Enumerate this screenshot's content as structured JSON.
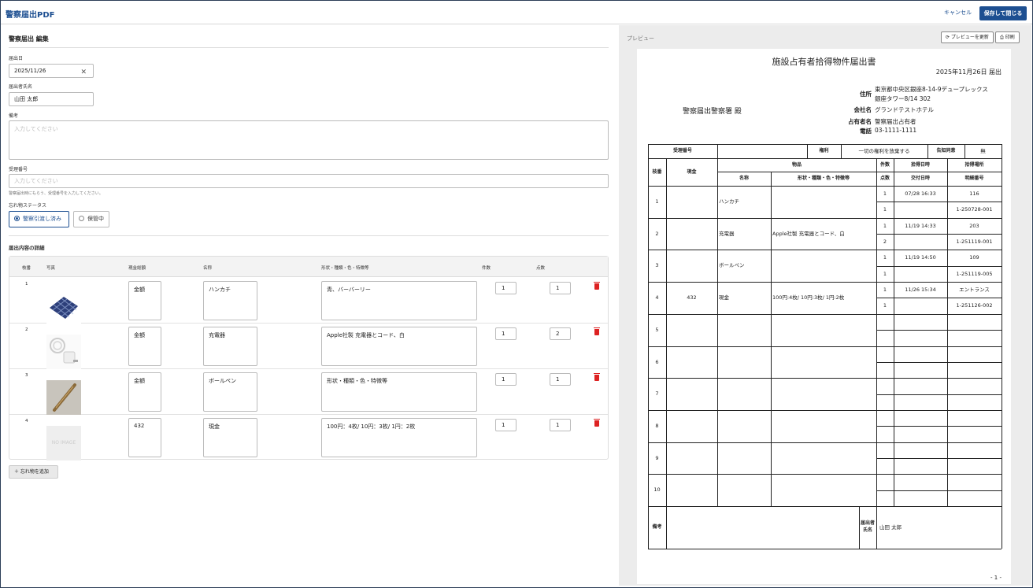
{
  "app": {
    "title": "警察届出PDF",
    "cancel": "キャンセル",
    "save_close": "保存して閉じる"
  },
  "editor": {
    "title": "警察届出 編集",
    "date_label": "届出日",
    "date_value": "2025/11/26",
    "name_label": "届出者氏名",
    "name_value": "山田 太郎",
    "remarks_label": "備考",
    "remarks_placeholder": "入力してください",
    "receipt_label": "受理番号",
    "receipt_placeholder": "入力してください",
    "receipt_help": "警察届出時にもらう、受理番号を入力してください。",
    "status_label": "忘れ物ステータス",
    "status_options": [
      "警察引渡し済み",
      "保管中"
    ],
    "status_selected": "警察引渡し済み",
    "details_title": "届出内容の詳細",
    "columns": [
      "枝番",
      "写真",
      "現金総額",
      "名称",
      "形状・種類・色・特徴等",
      "件数",
      "点数"
    ],
    "items": [
      {
        "no": "1",
        "photo": "blue-checkered-handkerchief",
        "cash": "",
        "cash_ph": "金額",
        "name": "ハンカチ",
        "desc": "青、バーバーリー",
        "count": "1",
        "points": "1"
      },
      {
        "no": "2",
        "photo": "white-charger-cable",
        "cash": "",
        "cash_ph": "金額",
        "name": "充電器",
        "desc": "Apple社製 充電器とコード、白",
        "count": "1",
        "points": "2"
      },
      {
        "no": "3",
        "photo": "gold-ballpoint-pen",
        "cash": "",
        "cash_ph": "金額",
        "name": "ボールペン",
        "desc": "",
        "desc_ph": "形状・種類・色・特徴等",
        "count": "1",
        "points": "1"
      },
      {
        "no": "4",
        "photo": "",
        "noimage": "NO IMAGE",
        "cash": "432",
        "name": "現金",
        "desc": "100円：4枚/ 10円：3枚/ 1円：2枚",
        "count": "1",
        "points": "1"
      }
    ],
    "add_label": "＋ 忘れ物を追加"
  },
  "preview": {
    "label": "プレビュー",
    "refresh": "⟳ プレビューを更新",
    "print": "印刷",
    "doc": {
      "title": "施設占有者拾得物件届出書",
      "date": "2025年11月26日 届出",
      "to": "警察届出警察署 殿",
      "address_k": "住所",
      "address_v1": "東京都中央区銀座8-14-9デュープレックス",
      "address_v2": "銀座タワー8/14 302",
      "company_k": "会社名",
      "company_v": "グランドテストホテル",
      "owner_k": "占有者名",
      "owner_v": "警察届出占有者",
      "tel_k": "電話",
      "tel_v": "03-1111-1111",
      "h_receipt": "受理番号",
      "h_right": "権利",
      "h_right_v": "一切の権利を放棄する",
      "h_notice": "告知同意",
      "h_notice_v": "無",
      "h_no": "枝番",
      "h_cash": "現金",
      "h_item": "物品",
      "h_count": "件数",
      "h_date": "拾得日時",
      "h_place": "拾得場所",
      "h_name": "名称",
      "h_desc": "形状・種類・色・特徴等",
      "h_points": "点数",
      "h_issue": "交付日時",
      "h_detail": "明細番号",
      "rows": [
        {
          "no": "1",
          "cash": "",
          "name": "ハンカチ",
          "desc": "",
          "count": "1",
          "points": "1",
          "date": "07/28 16:33",
          "issue": "",
          "place": "116",
          "detail": "1-250728-001"
        },
        {
          "no": "2",
          "cash": "",
          "name": "充電器",
          "desc": "Apple社製 充電器とコード、白",
          "count": "1",
          "points": "2",
          "date": "11/19 14:33",
          "issue": "",
          "place": "203",
          "detail": "1-251119-001"
        },
        {
          "no": "3",
          "cash": "",
          "name": "ボールペン",
          "desc": "",
          "count": "1",
          "points": "1",
          "date": "11/19 14:50",
          "issue": "",
          "place": "109",
          "detail": "1-251119-005"
        },
        {
          "no": "4",
          "cash": "432",
          "name": "現金",
          "desc": "100円:4枚/ 10円:3枚/ 1円:2枚",
          "count": "1",
          "points": "1",
          "date": "11/26 15:34",
          "issue": "",
          "place": "エントランス",
          "detail": "1-251126-002"
        },
        {
          "no": "5"
        },
        {
          "no": "6"
        },
        {
          "no": "7"
        },
        {
          "no": "8"
        },
        {
          "no": "9"
        },
        {
          "no": "10"
        }
      ],
      "remarks_k": "備考",
      "reporter_k": "届出者氏名",
      "reporter_v": "山田 太郎",
      "page": "- 1 -"
    }
  }
}
